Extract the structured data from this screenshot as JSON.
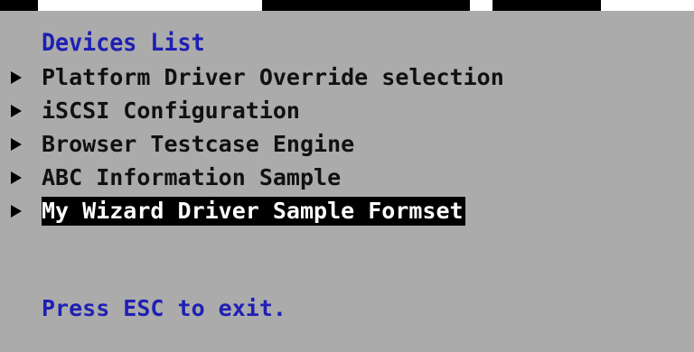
{
  "title": "Devices List",
  "menu_items": [
    {
      "label": "Platform Driver Override selection",
      "icon": "triangle-right-icon",
      "selected": false
    },
    {
      "label": "iSCSI Configuration",
      "icon": "triangle-right-icon",
      "selected": false
    },
    {
      "label": "Browser Testcase Engine",
      "icon": "triangle-right-icon",
      "selected": false
    },
    {
      "label": "ABC Information Sample",
      "icon": "triangle-right-icon",
      "selected": false
    },
    {
      "label": "My Wizard Driver Sample Formset",
      "icon": "triangle-right-icon",
      "selected": true
    }
  ],
  "footer": "Press ESC to exit.",
  "colors": {
    "background": "#ababab",
    "heading_text": "#1f1fb3",
    "item_text": "#111111",
    "selection_background": "#000000",
    "selection_text": "#ffffff"
  }
}
